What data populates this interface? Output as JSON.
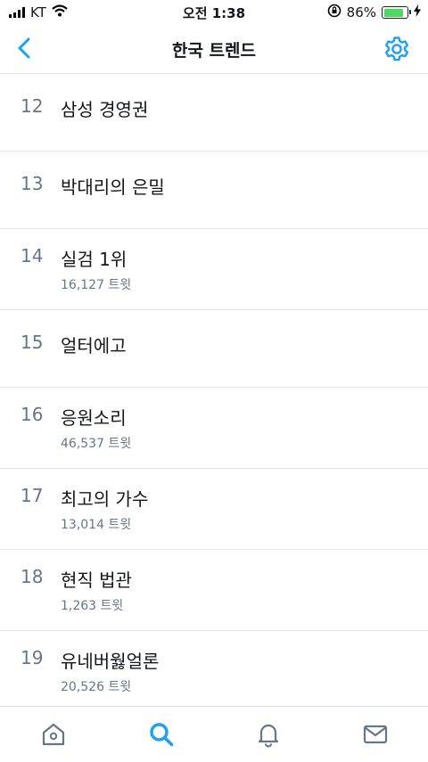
{
  "status_bar": {
    "carrier": "KT",
    "time": "오전 1:38",
    "battery_percent": "86%",
    "battery_level": 0.86
  },
  "nav": {
    "title": "한국 트렌드",
    "back_icon": "chevron-left-icon",
    "settings_icon": "gear-icon",
    "accent_color": "#1da1f2"
  },
  "trends": [
    {
      "rank": "12",
      "term": "삼성 경영권",
      "count": ""
    },
    {
      "rank": "13",
      "term": "박대리의 은밀",
      "count": ""
    },
    {
      "rank": "14",
      "term": "실검 1위",
      "count": "16,127 트윗"
    },
    {
      "rank": "15",
      "term": "얼터에고",
      "count": ""
    },
    {
      "rank": "16",
      "term": "응원소리",
      "count": "46,537 트윗"
    },
    {
      "rank": "17",
      "term": "최고의 가수",
      "count": "13,014 트윗"
    },
    {
      "rank": "18",
      "term": "현직 법관",
      "count": "1,263 트윗"
    },
    {
      "rank": "19",
      "term": "유네버웛얼론",
      "count": "20,526 트윗"
    }
  ],
  "tab_bar": {
    "tabs": [
      "home-icon",
      "search-icon",
      "notifications-icon",
      "messages-icon"
    ],
    "active": "search-icon"
  }
}
